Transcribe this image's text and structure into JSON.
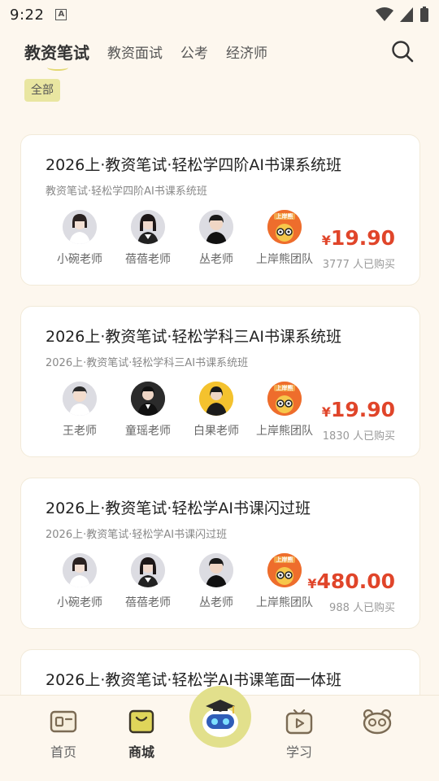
{
  "status": {
    "time": "9:22",
    "a_icon": "A"
  },
  "tabs": [
    {
      "label": "教资笔试"
    },
    {
      "label": "教资面试"
    },
    {
      "label": "公考"
    },
    {
      "label": "经济师"
    }
  ],
  "filter": {
    "label": "全部"
  },
  "courses": [
    {
      "title": "2026上·教资笔试·轻松学四阶AI书课系统班",
      "subtitle": "教资笔试·轻松学四阶AI书课系统班",
      "teachers": [
        "小碗老师",
        "蓓蓓老师",
        "丛老师",
        "上岸熊团队"
      ],
      "price_symbol": "¥",
      "price": "19.90",
      "bought": "3777 人已购买"
    },
    {
      "title": "2026上·教资笔试·轻松学科三AI书课系统班",
      "subtitle": "2026上·教资笔试·轻松学科三AI书课系统班",
      "teachers": [
        "王老师",
        "童瑶老师",
        "白果老师",
        "上岸熊团队"
      ],
      "price_symbol": "¥",
      "price": "19.90",
      "bought": "1830 人已购买"
    },
    {
      "title": "2026上·教资笔试·轻松学AI书课闪过班",
      "subtitle": "2026上·教资笔试·轻松学AI书课闪过班",
      "teachers": [
        "小碗老师",
        "蓓蓓老师",
        "丛老师",
        "上岸熊团队"
      ],
      "price_symbol": "¥",
      "price": "480.00",
      "bought": "988 人已购买"
    },
    {
      "title": "2026上·教资笔试·轻松学AI书课笔面一体班"
    }
  ],
  "team_badge": "上岸熊",
  "bottom_nav": [
    {
      "label": "首页"
    },
    {
      "label": "商城"
    },
    {
      "label": "学习"
    },
    {
      "label": ""
    }
  ],
  "colors": {
    "accent": "#e0452a",
    "chip": "#e9e6a1",
    "bg": "#fdf7ee"
  }
}
